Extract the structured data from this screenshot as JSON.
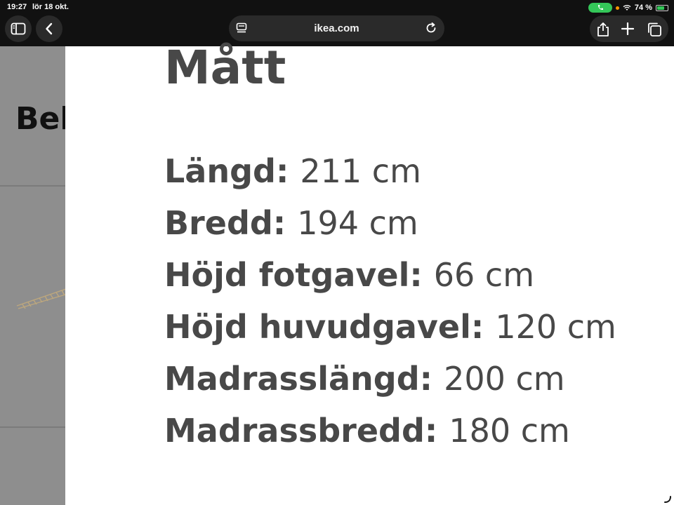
{
  "status_bar": {
    "time": "19:27",
    "date": "lör 18 okt.",
    "battery_percent": "74 %",
    "battery_level": 0.74
  },
  "browser": {
    "url": "ikea.com",
    "icons": {
      "sidebar": "sidebar-icon",
      "back": "chevron-left-icon",
      "page_menu": "page-menu-icon",
      "reload": "reload-icon",
      "share": "share-icon",
      "new_tab": "plus-icon",
      "tabs": "tabs-icon"
    }
  },
  "background_page": {
    "heading_partial": "Bel"
  },
  "sheet": {
    "title": "Mått",
    "dimensions": [
      {
        "label": "Längd:",
        "value": "211 cm"
      },
      {
        "label": "Bredd:",
        "value": "194 cm"
      },
      {
        "label": "Höjd fotgavel:",
        "value": "66 cm"
      },
      {
        "label": "Höjd huvudgavel:",
        "value": "120 cm"
      },
      {
        "label": "Madrasslängd:",
        "value": "200 cm"
      },
      {
        "label": "Madrassbredd:",
        "value": "180 cm"
      }
    ]
  },
  "colors": {
    "toolbar_bg": "#111111",
    "control_bg": "#2a2a2a",
    "text_dark": "#484848",
    "call_green": "#34c759",
    "dim_overlay": "#8e8e8e"
  }
}
